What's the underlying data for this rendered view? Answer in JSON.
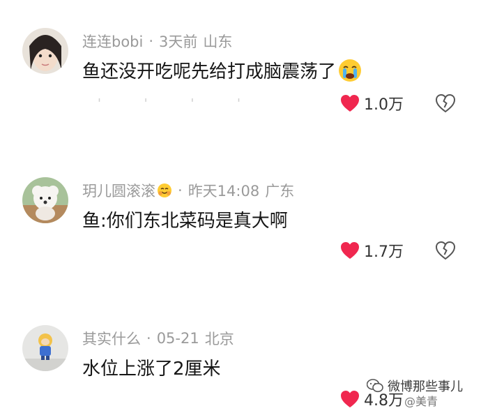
{
  "comments": [
    {
      "username": "连连bobi",
      "dot": "·",
      "time": "3天前",
      "location": "山东",
      "text": "鱼还没开吃呢先给打成脑震荡了",
      "likes": "1.0万"
    },
    {
      "username": "玥儿圆滚滚",
      "dot": "·",
      "time": "昨天14:08",
      "location": "广东",
      "text": "鱼:你们东北菜码是真大啊",
      "likes": "1.7万"
    },
    {
      "username": "其实什么",
      "dot": "·",
      "time": "05-21",
      "location": "北京",
      "text": "水位上涨了2厘米",
      "likes": "4.8万"
    }
  ],
  "icons": {
    "like": "heart-icon",
    "dislike": "broken-heart-icon",
    "like_color": "#f0274f"
  },
  "watermark": {
    "title": "微博那些事儿",
    "handle": "@美青"
  }
}
